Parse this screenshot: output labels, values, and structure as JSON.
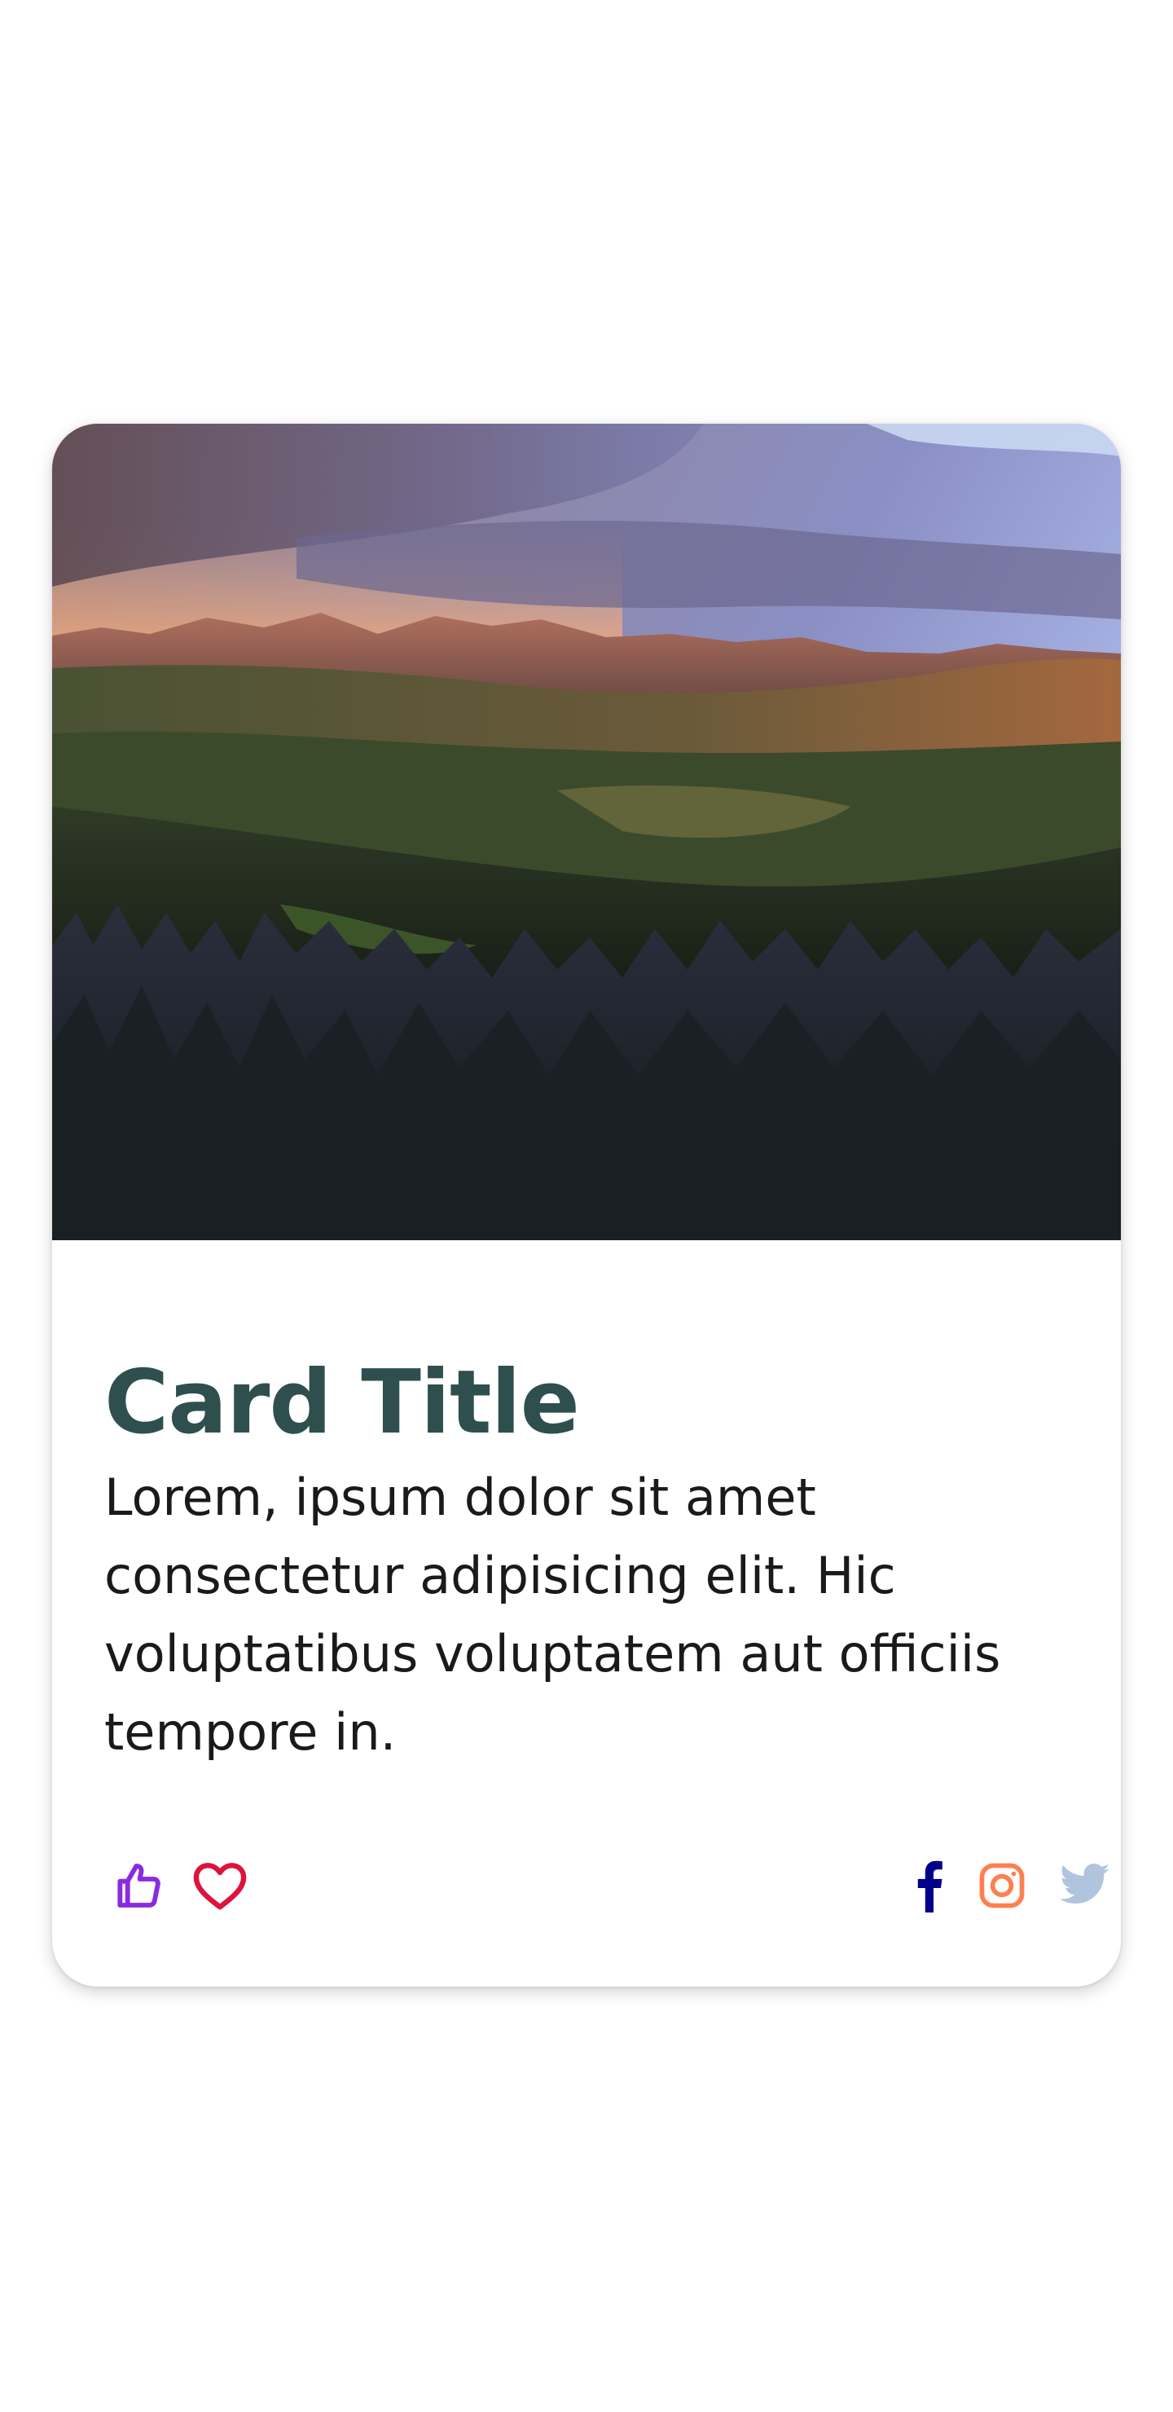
{
  "card": {
    "title": "Card Title",
    "text": "Lorem, ipsum dolor sit amet consectetur adipisicing elit. Hic voluptatibus voluptatem aut officiis tempore in."
  },
  "actions": {
    "left": [
      {
        "name": "thumbs-up-icon",
        "color": "#8a2be2"
      },
      {
        "name": "heart-icon",
        "color": "#dc143c"
      }
    ],
    "right": [
      {
        "name": "facebook-icon",
        "color": "#00008b"
      },
      {
        "name": "instagram-icon",
        "color": "#ff7f50"
      },
      {
        "name": "twitter-icon",
        "color": "#b0c4de"
      }
    ]
  },
  "colors": {
    "title": "#2f4f4f",
    "text": "#1a1a1a",
    "background": "#ffffff"
  }
}
